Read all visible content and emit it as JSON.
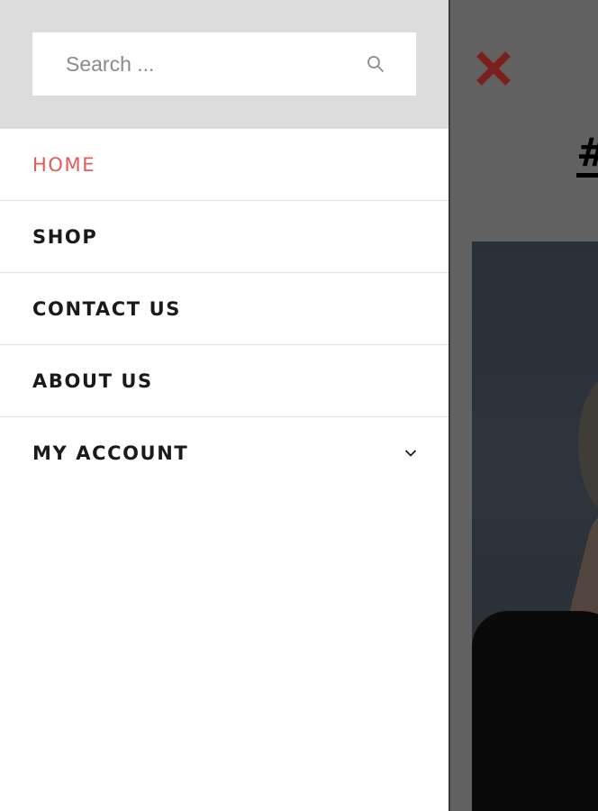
{
  "search": {
    "placeholder": "Search ..."
  },
  "page": {
    "heading_fragment": "#"
  },
  "menu": {
    "items": [
      {
        "label": "HOME",
        "active": true
      },
      {
        "label": "SHOP",
        "active": false
      },
      {
        "label": "CONTACT US",
        "active": false
      },
      {
        "label": "ABOUT US",
        "active": false
      },
      {
        "label": "MY ACCOUNT",
        "active": false,
        "has_submenu": true
      }
    ]
  },
  "icons": {
    "search": "search-icon",
    "close": "close-icon",
    "submenu": "chevron-down-icon"
  },
  "colors": {
    "active": "#e35a57",
    "close": "#7b1f1f",
    "search_bg": "#dcdcdc",
    "text": "#1a1a1a"
  }
}
